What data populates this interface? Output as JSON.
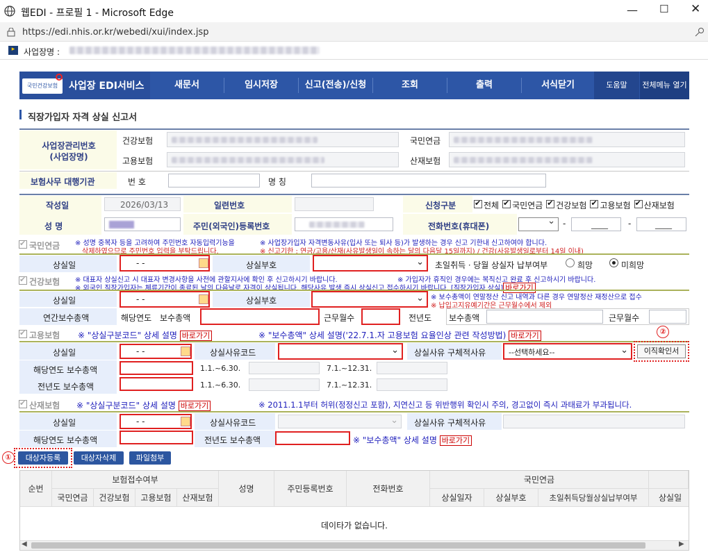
{
  "window": {
    "title": "웹EDI - 프로필 1 - Microsoft Edge",
    "url": "https://edi.nhis.or.kr/webedi/xui/index.jsp",
    "site_label": "사업장명 :"
  },
  "nav": {
    "brand_logo": "국민건강보험",
    "brand": "사업장 EDI서비스",
    "items": [
      "새문서",
      "임시저장",
      "신고(전송)/신청",
      "조회",
      "출력",
      "서식닫기"
    ],
    "help": "도움말",
    "menu": "전체메뉴 열기"
  },
  "page_title": "직장가입자 자격 상실 신고서",
  "biz": {
    "label": "사업장관리번호\n(사업장명)",
    "health": "건강보험",
    "employ": "고용보험",
    "pension": "국민연금",
    "industrial": "산재보험",
    "agency_label": "보험사무 대행기관",
    "number_label": "번 호",
    "name_label": "명 칭"
  },
  "form": {
    "date_label": "작성일",
    "date_value": "2026/03/13",
    "serial_label": "일련번호",
    "apply_label": "신청구분",
    "apply_options": [
      "전체",
      "국민연금",
      "건강보험",
      "고용보험",
      "산재보험"
    ],
    "name_label": "성 명",
    "rrn_label": "주민(외국인)등록번호",
    "phone_label": "전화번호(휴대폰)",
    "phone_sep": "-",
    "phone_mid": "____",
    "phone_last": "____"
  },
  "pension": {
    "header": "국민연금",
    "note1": "※ 성명 중복자 등을 고려하여 주민번호 자동입력기능을",
    "note1b": "삭제하였으므로 주민번호 입력을 부탁드립니다.",
    "note2": "※ 사업장가입자 자격변동사유(입사 또는 퇴사 등)가 발생하는 경우 신고 기한내 신고하여야 합니다.",
    "note3": "※ 신고기한 : 연금/고용/산재(사유발생일이 속하는 달의 다음달 15일까지) / 건강(사유발생일로부터 14일 이내)",
    "loss_date": "상실일",
    "date_placeholder": "-  -",
    "loss_code": "상실부호",
    "pay_label": "초일취득ㆍ당월 상실자 납부여부",
    "radio_yes": "희망",
    "radio_no": "미희망"
  },
  "health": {
    "header": "건강보험",
    "note1": "※ 대표자 상실신고 시 대표자 변경사항을 사전에 관할지사에 확인 후 신고하시기 바랍니다.",
    "note2": "※ 가입자가 휴직인 경우에는 복직신고 완료 후 신고하시기 바랍니다.",
    "note3": "※ 외국인 직장가입자는 체류기간이 종료된 날의 다음날로 자격이 상실됩니다. 해당사유 발생 즉시 상실신고 접수하시기 바랍니다. [직장가입자 상실]",
    "link": "바로가기",
    "note4": "※ 보수총액이 연말정산 신고 내역과 다른 경우 연말정산 재정산으로 접수",
    "note5": "※ 납입고지유예기간은 근무월수에서 제외",
    "loss_date": "상실일",
    "date_placeholder": "-  -",
    "loss_code": "상실부호",
    "annual_label": "연간보수총액",
    "this_year": "해당연도",
    "total_pay": "보수총액",
    "months": "근무월수",
    "prev_year": "전년도",
    "total_pay2": "보수총액",
    "months2": "근무월수"
  },
  "employ": {
    "header": "고용보험",
    "note1": "※ \"상실구분코드\" 상세 설명",
    "link1": "바로가기",
    "note2": "※ \"보수총액\" 상세 설명('22.7.1.자 고용보험 요율인상 관련 작성방법)",
    "link2": "바로가기",
    "loss_date": "상실일",
    "date_placeholder": "-  -",
    "reason_code": "상실사유코드",
    "reason_detail": "상실사유 구체적사유",
    "select_placeholder": "--선택하세요--",
    "transfer_btn": "이직확인서",
    "this_year_pay": "해당연도 보수총액",
    "prev_year_pay": "전년도 보수총액",
    "h1": "1.1.~6.30.",
    "h2": "7.1.~12.31.",
    "marker": "②"
  },
  "industrial": {
    "header": "산재보험",
    "note1": "※ \"상실구분코드\" 상세 설명",
    "link1": "바로가기",
    "note2": "※ 2011.1.1부터 허위(정정신고 포함), 지연신고 등 위반행위 확인시 주의, 경고없이 즉시 과태료가 부과됩니다.",
    "loss_date": "상실일",
    "date_placeholder": "-  -",
    "reason_code": "상실사유코드",
    "reason_detail": "상실사유 구체적사유",
    "this_year_pay": "해당연도 보수총액",
    "prev_year_pay": "전년도 보수총액",
    "note3": "※ \"보수총액\" 상세 설명",
    "link3": "바로가기"
  },
  "actions": {
    "register": "대상자등록",
    "delete": "대상자삭제",
    "attach": "파일첨부",
    "marker": "①"
  },
  "grid": {
    "col_no": "순번",
    "col_receipt": "보험접수여부",
    "sub": [
      "국민연금",
      "건강보험",
      "고용보험",
      "산재보험"
    ],
    "col_name": "성명",
    "col_rrn": "주민등록번호",
    "col_phone": "전화번호",
    "col_pension": "국민연금",
    "pension_sub": [
      "상실일자",
      "상실부호",
      "초일취득당월상실납부여부",
      "상실일자"
    ],
    "empty": "데이타가 없습니다."
  },
  "colors": {
    "nav": "#2d56a6",
    "accent_red": "#e02020",
    "label_blue": "#2f3f85"
  }
}
